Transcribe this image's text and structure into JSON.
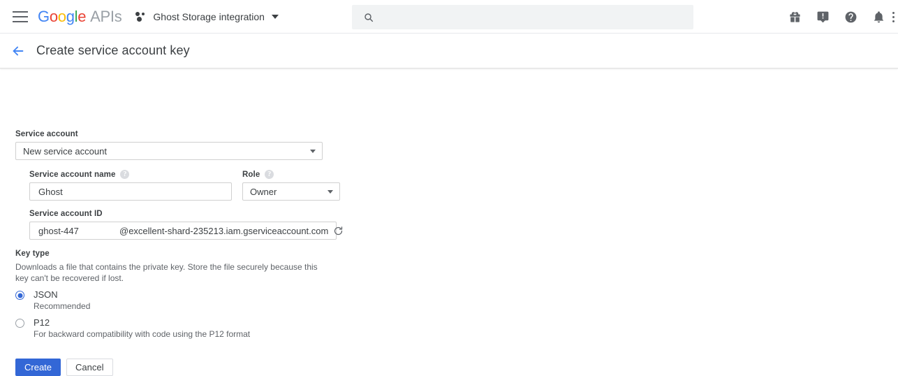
{
  "topbar": {
    "menu_icon": "hamburger-icon",
    "logo": {
      "g1": "G",
      "o1": "o",
      "o2": "o",
      "g2": "g",
      "l": "l",
      "e": "e",
      "suffix": "APIs"
    },
    "project_icon": "project-dots-icon",
    "project_name": "Ghost Storage integration",
    "project_caret": "chevron-down-icon",
    "search": {
      "value": "",
      "placeholder": "",
      "icon": "search-icon"
    },
    "icons": [
      {
        "name": "gift-icon",
        "label": "Gift"
      },
      {
        "name": "feedback-icon",
        "label": "Send feedback"
      },
      {
        "name": "help-icon",
        "label": "Help"
      },
      {
        "name": "notifications-icon",
        "label": "Notifications"
      },
      {
        "name": "more-vert-icon",
        "label": "More"
      }
    ]
  },
  "page": {
    "back_icon": "arrow-back-icon",
    "title": "Create service account key"
  },
  "form": {
    "service_account": {
      "label": "Service account",
      "value": "New service account"
    },
    "service_account_name": {
      "label": "Service account name",
      "value": "Ghost",
      "help_icon": "help-circle-icon",
      "help_glyph": "?"
    },
    "role": {
      "label": "Role",
      "value": "Owner",
      "help_icon": "help-circle-icon",
      "help_glyph": "?"
    },
    "service_account_id": {
      "label": "Service account ID",
      "value": "ghost-447",
      "domain": "@excellent-shard-235213.iam.gserviceaccount.com",
      "refresh_icon": "refresh-icon"
    },
    "key_type": {
      "label": "Key type",
      "description": "Downloads a file that contains the private key. Store the file securely because this key can't be recovered if lost.",
      "options": [
        {
          "id": "json",
          "label": "JSON",
          "sub": "Recommended",
          "selected": true
        },
        {
          "id": "p12",
          "label": "P12",
          "sub": "For backward compatibility with code using the P12 format",
          "selected": false
        }
      ]
    },
    "buttons": {
      "create": "Create",
      "cancel": "Cancel"
    }
  },
  "colors": {
    "accent_blue": "#3367d6",
    "link_blue": "#4285f4",
    "google_blue": "#4285f4",
    "google_red": "#ea4335",
    "google_yellow": "#fbbc05",
    "google_green": "#34a853",
    "text": "#3c4043",
    "muted": "#5f6368",
    "search_bg": "#f1f3f4"
  }
}
